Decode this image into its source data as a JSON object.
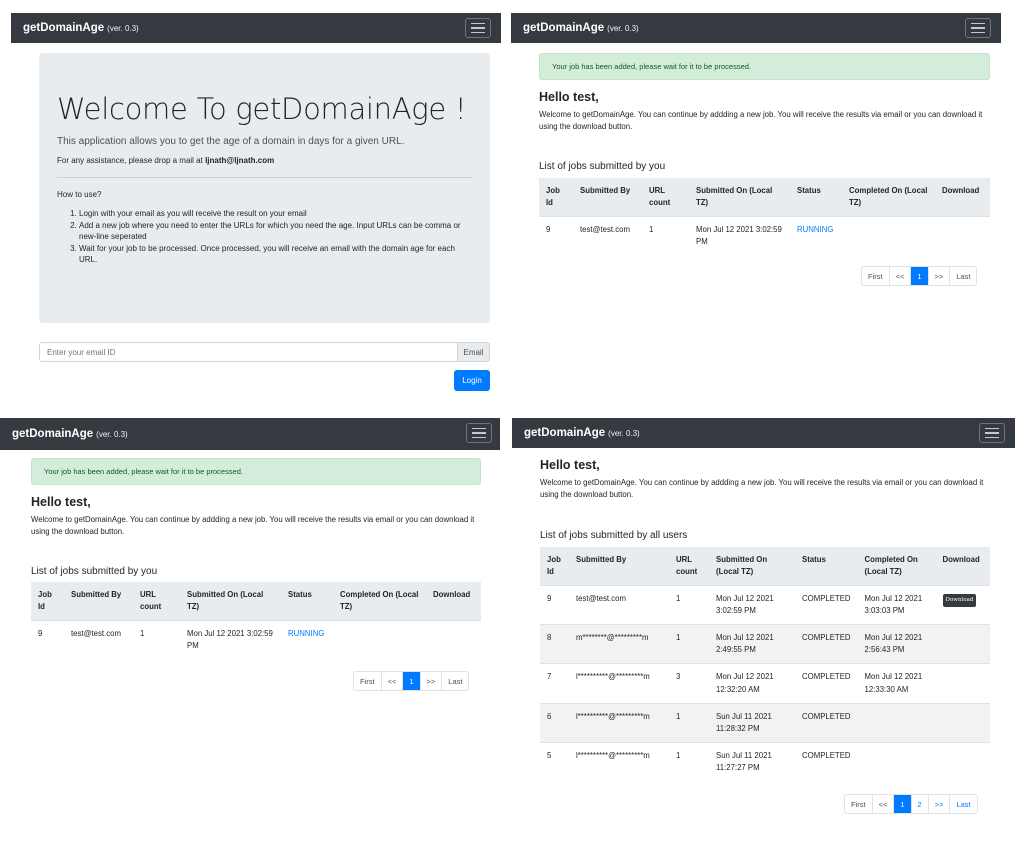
{
  "app": {
    "brand": "getDomainAge",
    "version": "(ver. 0.3)"
  },
  "login": {
    "title": "Welcome To getDomainAge !",
    "lead": "This application allows you to get the age of a domain in days for a given URL.",
    "assist_prefix": "For any assistance, please drop a mail at ",
    "assist_email": "ljnath@ljnath.com",
    "howto": "How to use?",
    "steps": [
      "Login with your email as you will receive the result on your email",
      "Add a new job where you need to enter the URLs for which you need the age. Input URLs can be comma or new-line seperated",
      "Wait for your job to be processed. Once processed, you will receive an email with the domain age for each URL."
    ],
    "email_placeholder": "Enter your email ID",
    "email_addon": "Email",
    "login_button": "Login"
  },
  "dashboard": {
    "alert": "Your job has been added, please wait for it to be processed.",
    "hello": "Hello test,",
    "welcome": "Welcome to getDomainAge. You can continue by addding a new job. You will receive the results via email or you can download it using the download button.",
    "list_title_user": "List of jobs submitted by you",
    "list_title_all": "List of jobs submitted by all users",
    "columns": {
      "job_id": "Job Id",
      "submitted_by": "Submitted By",
      "url_count": "URL count",
      "submitted_on": "Submitted On (Local TZ)",
      "status": "Status",
      "completed_on": "Completed On (Local TZ)",
      "download": "Download"
    },
    "user_jobs": [
      {
        "id": "9",
        "by": "test@test.com",
        "count": "1",
        "submitted": "Mon Jul 12 2021 3:02:59 PM",
        "status": "RUNNING",
        "completed": ""
      }
    ],
    "all_jobs": [
      {
        "id": "9",
        "by": "test@test.com",
        "count": "1",
        "submitted": "Mon Jul 12 2021 3:02:59 PM",
        "status": "COMPLETED",
        "completed": "Mon Jul 12 2021 3:03:03 PM",
        "download": "Download"
      },
      {
        "id": "8",
        "by": "m********@*********m",
        "count": "1",
        "submitted": "Mon Jul 12 2021 2:49:55 PM",
        "status": "COMPLETED",
        "completed": "Mon Jul 12 2021 2:56:43 PM",
        "download": ""
      },
      {
        "id": "7",
        "by": "l**********@*********m",
        "count": "3",
        "submitted": "Mon Jul 12 2021 12:32:20 AM",
        "status": "COMPLETED",
        "completed": "Mon Jul 12 2021 12:33:30 AM",
        "download": ""
      },
      {
        "id": "6",
        "by": "l**********@*********m",
        "count": "1",
        "submitted": "Sun Jul 11 2021 11:28:32 PM",
        "status": "COMPLETED",
        "completed": "",
        "download": ""
      },
      {
        "id": "5",
        "by": "l**********@*********m",
        "count": "1",
        "submitted": "Sun Jul 11 2021 11:27:27 PM",
        "status": "COMPLETED",
        "completed": "",
        "download": ""
      }
    ],
    "pager": {
      "first": "First",
      "prev": "<<",
      "page1": "1",
      "page2": "2",
      "next": ">>",
      "last": "Last"
    }
  }
}
